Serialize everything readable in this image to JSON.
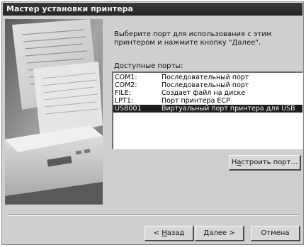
{
  "window": {
    "title": "Мастер установки принтера"
  },
  "instructions": "Выберите порт для использования с этим принтером и нажмите кнопку \"Далее\".",
  "ports_label": "Доступные порты:",
  "ports": [
    {
      "port": "COM1:",
      "description": "Последовательный порт",
      "selected": false
    },
    {
      "port": "COM2:",
      "description": "Последовательный порт",
      "selected": false
    },
    {
      "port": "FILE:",
      "description": "Создает файл на диске",
      "selected": false
    },
    {
      "port": "LPT1:",
      "description": "Порт принтера ECP",
      "selected": false
    },
    {
      "port": "USB001",
      "description": "Виртуальный порт принтера для USB",
      "selected": true
    }
  ],
  "buttons": {
    "configure": {
      "pre": "Н",
      "mnemonic": "а",
      "post": "строить порт..."
    },
    "back": {
      "pre": "< ",
      "mnemonic": "Н",
      "post": "азад"
    },
    "next": "Далее >",
    "cancel": "Отмена"
  },
  "colors": {
    "title_bar": "#2e2e2e",
    "dialog_bg": "#cfcfcf",
    "selection": "#1e1e1e"
  }
}
